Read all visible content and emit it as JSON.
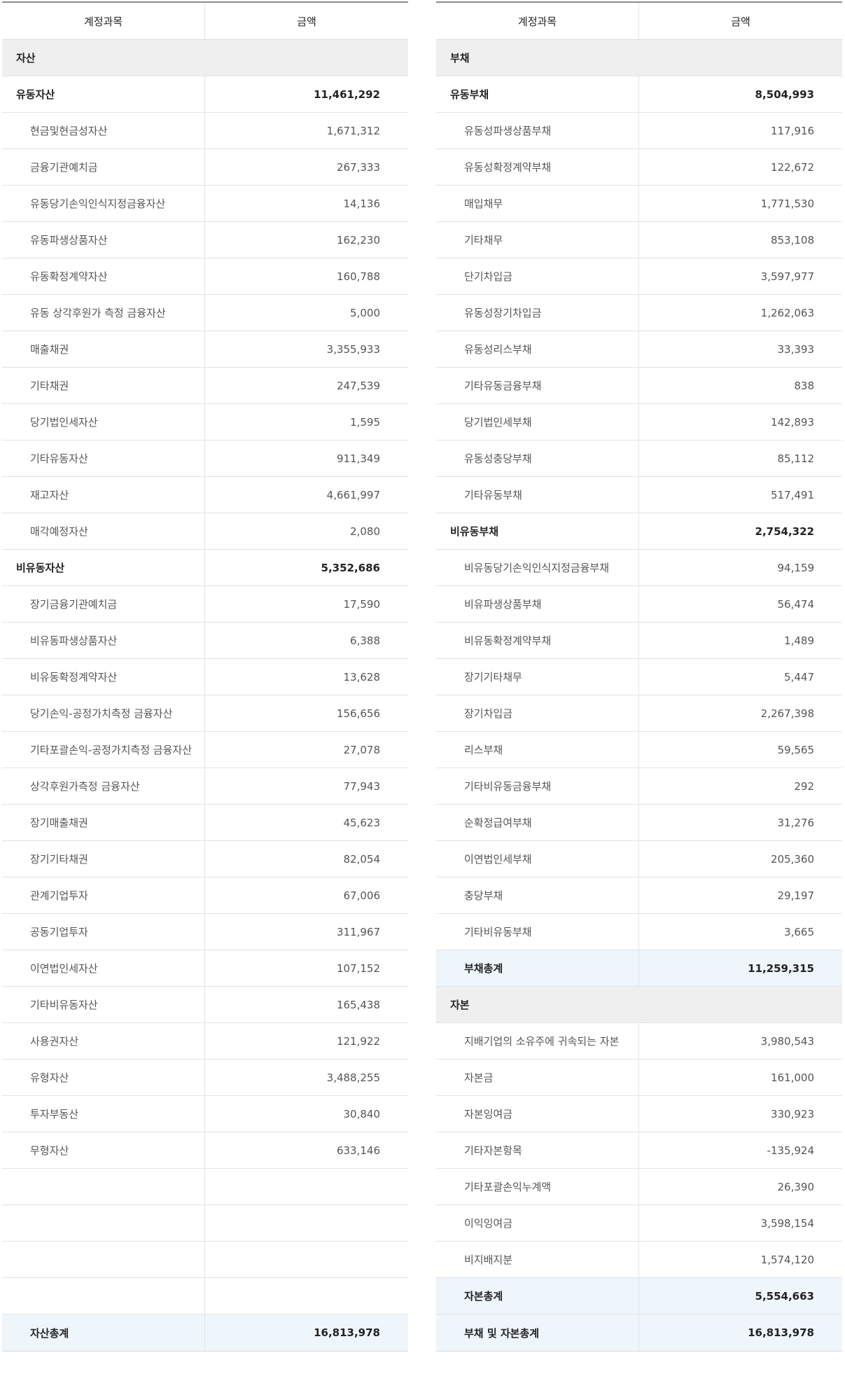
{
  "headers": {
    "account": "계정과목",
    "amount": "금액"
  },
  "left": [
    {
      "type": "section",
      "name": "자산",
      "amount": ""
    },
    {
      "type": "group",
      "name": "유동자산",
      "amount": "11,461,292"
    },
    {
      "type": "item",
      "name": "현금및현금성자산",
      "amount": "1,671,312"
    },
    {
      "type": "item",
      "name": "금융기관예치금",
      "amount": "267,333"
    },
    {
      "type": "item",
      "name": "유동당기손익인식지정금융자산",
      "amount": "14,136"
    },
    {
      "type": "item",
      "name": "유동파생상품자산",
      "amount": "162,230"
    },
    {
      "type": "item",
      "name": "유동확정계약자산",
      "amount": "160,788"
    },
    {
      "type": "item",
      "name": "유동 상각후원가 측정 금융자산",
      "amount": "5,000"
    },
    {
      "type": "item",
      "name": "매출채권",
      "amount": "3,355,933"
    },
    {
      "type": "item",
      "name": "기타채권",
      "amount": "247,539"
    },
    {
      "type": "item",
      "name": "당기법인세자산",
      "amount": "1,595"
    },
    {
      "type": "item",
      "name": "기타유동자산",
      "amount": "911,349"
    },
    {
      "type": "item",
      "name": "재고자산",
      "amount": "4,661,997"
    },
    {
      "type": "item",
      "name": "매각예정자산",
      "amount": "2,080"
    },
    {
      "type": "group",
      "name": "비유동자산",
      "amount": "5,352,686"
    },
    {
      "type": "item",
      "name": "장기금융기관예치금",
      "amount": "17,590"
    },
    {
      "type": "item",
      "name": "비유동파생상품자산",
      "amount": "6,388"
    },
    {
      "type": "item",
      "name": "비유동확정계약자산",
      "amount": "13,628"
    },
    {
      "type": "item",
      "name": "당기손익-공정가치측정 금융자산",
      "amount": "156,656"
    },
    {
      "type": "item",
      "name": "기타포괄손익-공정가치측정 금융자산",
      "amount": "27,078"
    },
    {
      "type": "item",
      "name": "상각후원가측정 금융자산",
      "amount": "77,943"
    },
    {
      "type": "item",
      "name": "장기매출채권",
      "amount": "45,623"
    },
    {
      "type": "item",
      "name": "장기기타채권",
      "amount": "82,054"
    },
    {
      "type": "item",
      "name": "관계기업투자",
      "amount": "67,006"
    },
    {
      "type": "item",
      "name": "공동기업투자",
      "amount": "311,967"
    },
    {
      "type": "item",
      "name": "이연법인세자산",
      "amount": "107,152"
    },
    {
      "type": "item",
      "name": "기타비유동자산",
      "amount": "165,438"
    },
    {
      "type": "item",
      "name": "사용권자산",
      "amount": "121,922"
    },
    {
      "type": "item",
      "name": "유형자산",
      "amount": "3,488,255"
    },
    {
      "type": "item",
      "name": "투자부동산",
      "amount": "30,840"
    },
    {
      "type": "item",
      "name": "무형자산",
      "amount": "633,146"
    },
    {
      "type": "empty",
      "name": "",
      "amount": ""
    },
    {
      "type": "empty",
      "name": "",
      "amount": ""
    },
    {
      "type": "empty",
      "name": "",
      "amount": ""
    },
    {
      "type": "empty",
      "name": "",
      "amount": ""
    },
    {
      "type": "total",
      "name": "자산총계",
      "amount": "16,813,978"
    }
  ],
  "right": [
    {
      "type": "section",
      "name": "부채",
      "amount": ""
    },
    {
      "type": "group",
      "name": "유동부채",
      "amount": "8,504,993"
    },
    {
      "type": "item",
      "name": "유동성파생상품부채",
      "amount": "117,916"
    },
    {
      "type": "item",
      "name": "유동성확정계약부채",
      "amount": "122,672"
    },
    {
      "type": "item",
      "name": "매입채무",
      "amount": "1,771,530"
    },
    {
      "type": "item",
      "name": "기타채무",
      "amount": "853,108"
    },
    {
      "type": "item",
      "name": "단기차입금",
      "amount": "3,597,977"
    },
    {
      "type": "item",
      "name": "유동성장기차입금",
      "amount": "1,262,063"
    },
    {
      "type": "item",
      "name": "유동성리스부채",
      "amount": "33,393"
    },
    {
      "type": "item",
      "name": "기타유동금융부채",
      "amount": "838"
    },
    {
      "type": "item",
      "name": "당기법인세부채",
      "amount": "142,893"
    },
    {
      "type": "item",
      "name": "유동성충당부채",
      "amount": "85,112"
    },
    {
      "type": "item",
      "name": "기타유동부채",
      "amount": "517,491"
    },
    {
      "type": "group",
      "name": "비유동부채",
      "amount": "2,754,322"
    },
    {
      "type": "item",
      "name": "비유동당기손익인식지정금융부채",
      "amount": "94,159"
    },
    {
      "type": "item",
      "name": "비유파생상품부채",
      "amount": "56,474"
    },
    {
      "type": "item",
      "name": "비유동확정계약부채",
      "amount": "1,489"
    },
    {
      "type": "item",
      "name": "장기기타채무",
      "amount": "5,447"
    },
    {
      "type": "item",
      "name": "장기차입금",
      "amount": "2,267,398"
    },
    {
      "type": "item",
      "name": "리스부채",
      "amount": "59,565"
    },
    {
      "type": "item",
      "name": "기타비유동금융부채",
      "amount": "292"
    },
    {
      "type": "item",
      "name": "순확정급여부채",
      "amount": "31,276"
    },
    {
      "type": "item",
      "name": "이연법인세부채",
      "amount": "205,360"
    },
    {
      "type": "item",
      "name": "충당부채",
      "amount": "29,197"
    },
    {
      "type": "item",
      "name": "기타비유동부채",
      "amount": "3,665"
    },
    {
      "type": "total",
      "name": "부채총계",
      "amount": "11,259,315"
    },
    {
      "type": "section",
      "name": "자본",
      "amount": ""
    },
    {
      "type": "item",
      "name": "지배기업의 소유주에 귀속되는 자본",
      "amount": "3,980,543"
    },
    {
      "type": "item",
      "name": "자본금",
      "amount": "161,000"
    },
    {
      "type": "item",
      "name": "자본잉여금",
      "amount": "330,923"
    },
    {
      "type": "item",
      "name": "기타자본항목",
      "amount": "-135,924"
    },
    {
      "type": "item",
      "name": "기타포괄손익누계액",
      "amount": "26,390"
    },
    {
      "type": "item",
      "name": "이익잉여금",
      "amount": "3,598,154"
    },
    {
      "type": "item",
      "name": "비지배지분",
      "amount": "1,574,120"
    },
    {
      "type": "total",
      "name": "자본총계",
      "amount": "5,554,663"
    },
    {
      "type": "total",
      "name": "부채 및 자본총계",
      "amount": "16,813,978"
    }
  ]
}
